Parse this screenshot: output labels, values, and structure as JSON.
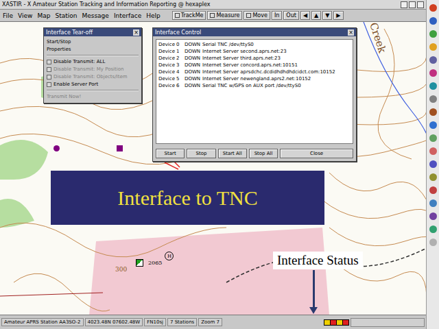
{
  "window": {
    "title": "XASTIR - X Amateur Station Tracking and Information Reporting @ hexaplex"
  },
  "menu": [
    "File",
    "View",
    "Map",
    "Station",
    "Message",
    "Interface",
    "Help"
  ],
  "toolbar": {
    "toggles": [
      {
        "label": "TrackMe",
        "checked": false
      },
      {
        "label": "Measure",
        "checked": false
      },
      {
        "label": "Move",
        "checked": false
      }
    ],
    "buttons": [
      "In",
      "Out",
      "◀",
      "▲",
      "▼",
      "▶"
    ]
  },
  "map_labels": [
    {
      "text": "Creek"
    },
    {
      "text": "2065"
    },
    {
      "text": "300"
    },
    {
      "text": "H"
    }
  ],
  "tearoff": {
    "title": "Interface Tear-off",
    "items": [
      {
        "kind": "action",
        "label": "Start/Stop",
        "disabled": false
      },
      {
        "kind": "action",
        "label": "Properties",
        "disabled": false
      },
      {
        "kind": "separator"
      },
      {
        "kind": "checkbox",
        "label": "Disable Transmit: ALL",
        "checked": false,
        "disabled": false
      },
      {
        "kind": "checkbox",
        "label": "Disable Transmit: My Position",
        "checked": false,
        "disabled": true
      },
      {
        "kind": "checkbox",
        "label": "Disable Transmit: Objects/Item",
        "checked": false,
        "disabled": true
      },
      {
        "kind": "checkbox",
        "label": "Enable Server Port",
        "checked": false,
        "disabled": false
      },
      {
        "kind": "separator"
      },
      {
        "kind": "action",
        "label": "Transmit Now!",
        "disabled": true
      }
    ]
  },
  "control": {
    "title": "Interface Control",
    "devices": [
      {
        "label": "Device",
        "number": "0",
        "status": "DOWN",
        "description": "Serial TNC /dev/ttyS0"
      },
      {
        "label": "Device",
        "number": "1",
        "status": "DOWN",
        "description": "Internet Server second.aprs.net:23"
      },
      {
        "label": "Device",
        "number": "2",
        "status": "DOWN",
        "description": "Internet Server third.aprs.net:23"
      },
      {
        "label": "Device",
        "number": "3",
        "status": "DOWN",
        "description": "Internet Server concord.aprs.net:10151"
      },
      {
        "label": "Device",
        "number": "4",
        "status": "DOWN",
        "description": "Internet Server aprsdchc.dcdidhdhdhdcidct.com:10152"
      },
      {
        "label": "Device",
        "number": "5",
        "status": "DOWN",
        "description": "Internet Server newengland.aprs2.net:10152"
      },
      {
        "label": "Device",
        "number": "6",
        "status": "DOWN",
        "description": "Serial TNC w/GPS on AUX port /dev/ttyS0"
      }
    ],
    "buttons": [
      "Start",
      "Stop",
      "Start All",
      "Stop All",
      "Close"
    ]
  },
  "banner": {
    "text": "Interface to TNC"
  },
  "annotation": {
    "text": "Interface Status"
  },
  "status_bar": {
    "fields": [
      "Amateur APRS Station AA3SO-2",
      "4023.48N  07602.48W",
      "FN10sj",
      "7 Stations",
      "Zoom 7"
    ],
    "interfaces": [
      {
        "color": "#f0d000"
      },
      {
        "color": "#e02020"
      },
      {
        "color": "#f0d000"
      },
      {
        "color": "#e02020"
      }
    ]
  }
}
